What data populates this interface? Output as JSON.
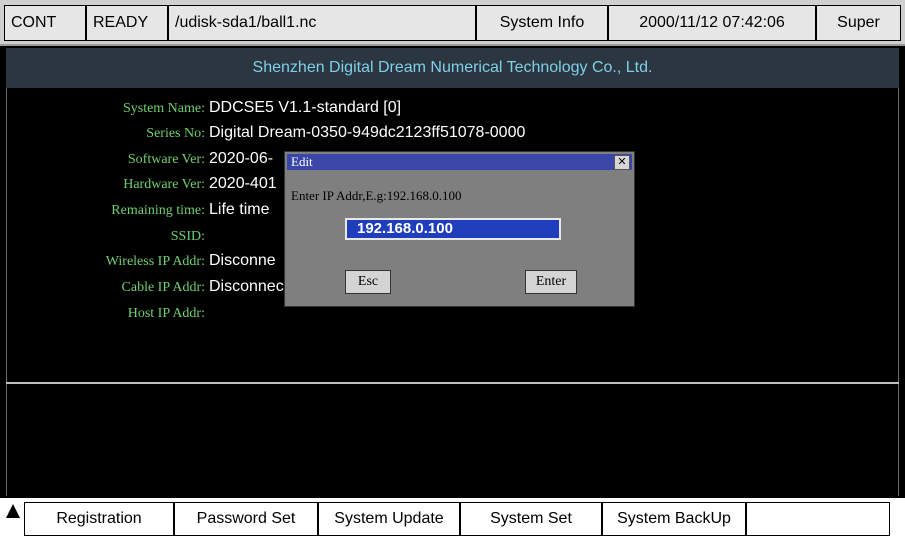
{
  "status_bar": {
    "mode": "CONT",
    "state": "READY",
    "file_path": "/udisk-sda1/ball1.nc",
    "page_title": "System Info",
    "datetime": "2000/11/12 07:42:06",
    "user_level": "Super"
  },
  "company_name": "Shenzhen Digital Dream Numerical Technology Co., Ltd.",
  "info_rows": [
    {
      "label": "System Name:",
      "value": "DDCSE5 V1.1-standard [0]"
    },
    {
      "label": "Series No:",
      "value": "Digital Dream-0350-949dc2123ff51078-0000"
    },
    {
      "label": "Software Ver:",
      "value": "2020-06-"
    },
    {
      "label": "Hardware Ver:",
      "value": "2020-401"
    },
    {
      "label": "Remaining time:",
      "value": "Life time"
    },
    {
      "label": "SSID:",
      "value": ""
    },
    {
      "label": "Wireless IP Addr:",
      "value": "Disconne"
    },
    {
      "label": "Cable IP Addr:",
      "value": "Disconnect"
    },
    {
      "label": "Host IP Addr:",
      "value": ""
    }
  ],
  "dialog": {
    "title": "Edit",
    "close_glyph": "✕",
    "prompt": "Enter IP Addr,E.g:192.168.0.100",
    "input_value": "192.168.0.100",
    "esc_label": "Esc",
    "enter_label": "Enter"
  },
  "bottom_menu": {
    "items": [
      "Registration",
      "Password Set",
      "System Update",
      "System Set",
      "System BackUp",
      ""
    ]
  },
  "colors": {
    "label_green": "#6fcf6f",
    "company_cyan": "#7fcfe8",
    "dialog_title_blue": "#3a46a8",
    "input_blue": "#1f3ebc"
  }
}
